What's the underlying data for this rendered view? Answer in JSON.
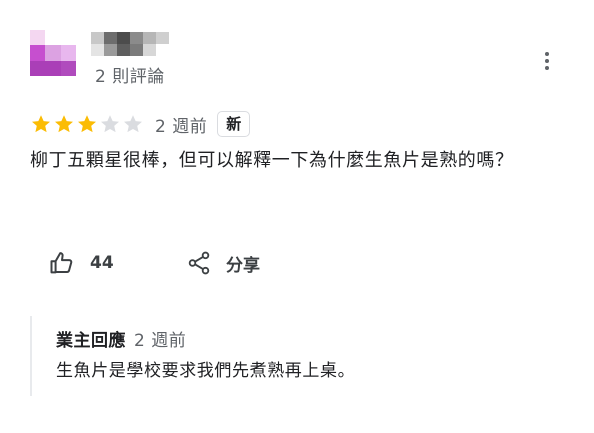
{
  "reviewer": {
    "avatar_icon": "pixelated-avatar",
    "review_count": "2 則評論"
  },
  "menu": {
    "icon": "more-vert-icon"
  },
  "rating": {
    "stars": 3,
    "out_of": 5,
    "star_color": "#fbbc04",
    "empty_star_color": "#dadce0",
    "date": "2 週前",
    "new_badge": "新"
  },
  "review": {
    "text": "柳丁五顆星很棒，但可以解釋一下為什麼生魚片是熟的嗎？"
  },
  "actions": {
    "like_icon": "thumbs-up-icon",
    "like_count": "44",
    "share_icon": "share-icon",
    "share_label": "分享"
  },
  "owner_reply": {
    "title": "業主回應",
    "date": "2 週前",
    "text": "生魚片是學校要求我們先煮熟再上桌。"
  }
}
